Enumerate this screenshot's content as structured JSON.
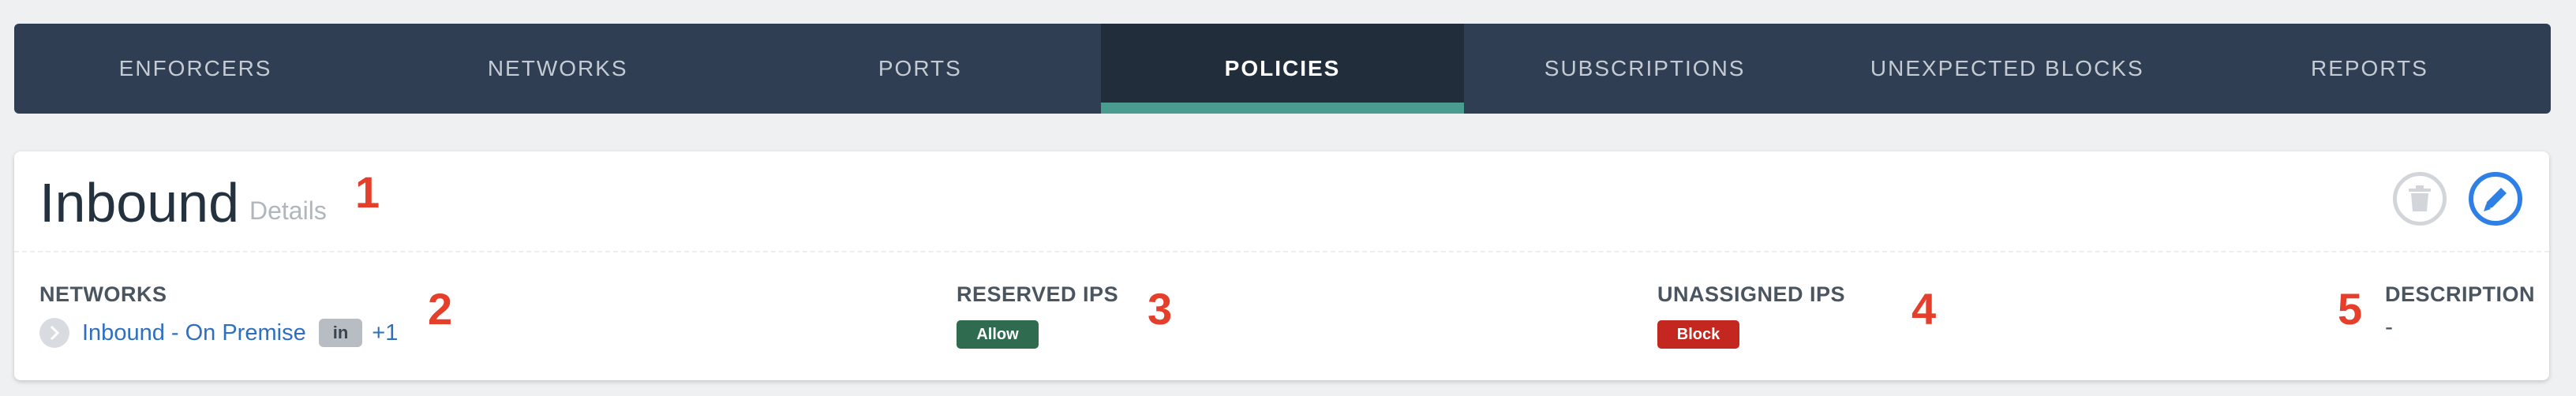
{
  "nav": {
    "tabs": [
      {
        "label": "ENFORCERS",
        "active": false
      },
      {
        "label": "NETWORKS",
        "active": false
      },
      {
        "label": "PORTS",
        "active": false
      },
      {
        "label": "POLICIES",
        "active": true
      },
      {
        "label": "SUBSCRIPTIONS",
        "active": false
      },
      {
        "label": "UNEXPECTED BLOCKS",
        "active": false
      },
      {
        "label": "REPORTS",
        "active": false
      }
    ],
    "accent_color": "#4a9c8e"
  },
  "policy": {
    "title": "Inbound",
    "subtitle": "Details",
    "actions": {
      "delete_icon": "trash-icon",
      "edit_icon": "pencil-icon",
      "edit_color": "#2f80e6"
    },
    "networks": {
      "label": "NETWORKS",
      "items": [
        {
          "name": "Inbound - On Premise",
          "direction": "in"
        }
      ],
      "more": "+1"
    },
    "reserved_ips": {
      "label": "RESERVED IPS",
      "value": "Allow",
      "color": "#2e6b4f"
    },
    "unassigned_ips": {
      "label": "UNASSIGNED IPS",
      "value": "Block",
      "color": "#c4271f"
    },
    "description": {
      "label": "DESCRIPTION",
      "value": "-"
    }
  },
  "markers": [
    "1",
    "2",
    "3",
    "4",
    "5"
  ]
}
